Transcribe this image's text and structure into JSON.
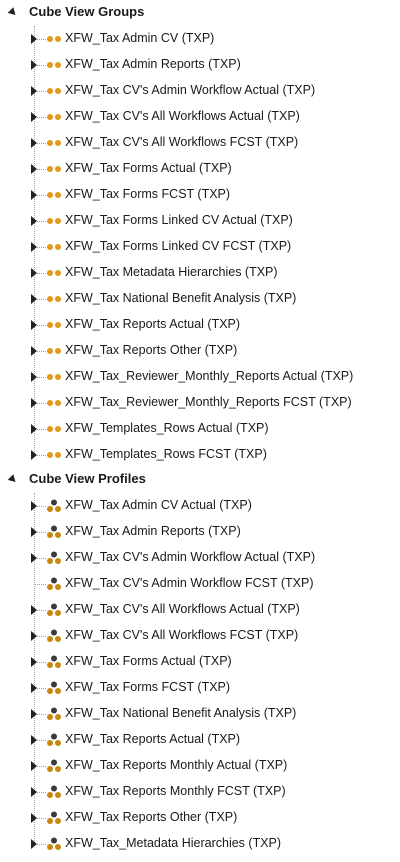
{
  "groups": [
    {
      "label": "Cube View Groups",
      "items": [
        {
          "label": "XFW_Tax Admin CV (TXP)",
          "expandable": true
        },
        {
          "label": "XFW_Tax Admin Reports (TXP)",
          "expandable": true
        },
        {
          "label": "XFW_Tax CV's Admin Workflow Actual (TXP)",
          "expandable": true
        },
        {
          "label": "XFW_Tax CV's All Workflows Actual (TXP)",
          "expandable": true
        },
        {
          "label": "XFW_Tax CV's All Workflows FCST (TXP)",
          "expandable": true
        },
        {
          "label": "XFW_Tax Forms Actual (TXP)",
          "expandable": true
        },
        {
          "label": "XFW_Tax Forms FCST (TXP)",
          "expandable": true
        },
        {
          "label": "XFW_Tax Forms Linked CV Actual (TXP)",
          "expandable": true
        },
        {
          "label": "XFW_Tax Forms Linked CV FCST (TXP)",
          "expandable": true
        },
        {
          "label": "XFW_Tax Metadata Hierarchies (TXP)",
          "expandable": true
        },
        {
          "label": "XFW_Tax National Benefit Analysis (TXP)",
          "expandable": true
        },
        {
          "label": "XFW_Tax Reports Actual (TXP)",
          "expandable": true
        },
        {
          "label": "XFW_Tax Reports Other (TXP)",
          "expandable": true
        },
        {
          "label": "XFW_Tax_Reviewer_Monthly_Reports Actual (TXP)",
          "expandable": true
        },
        {
          "label": "XFW_Tax_Reviewer_Monthly_Reports FCST (TXP)",
          "expandable": true
        },
        {
          "label": "XFW_Templates_Rows Actual (TXP)",
          "expandable": true
        },
        {
          "label": "XFW_Templates_Rows FCST (TXP)",
          "expandable": true
        }
      ]
    },
    {
      "label": "Cube View Profiles",
      "items": [
        {
          "label": "XFW_Tax Admin CV Actual (TXP)",
          "expandable": true
        },
        {
          "label": "XFW_Tax Admin Reports (TXP)",
          "expandable": true
        },
        {
          "label": "XFW_Tax CV's Admin Workflow Actual (TXP)",
          "expandable": true
        },
        {
          "label": "XFW_Tax CV's Admin Workflow FCST (TXP)",
          "expandable": false
        },
        {
          "label": "XFW_Tax CV's All Workflows Actual (TXP)",
          "expandable": true
        },
        {
          "label": "XFW_Tax CV's All Workflows FCST (TXP)",
          "expandable": true
        },
        {
          "label": "XFW_Tax Forms Actual (TXP)",
          "expandable": true
        },
        {
          "label": "XFW_Tax Forms FCST (TXP)",
          "expandable": true
        },
        {
          "label": "XFW_Tax National Benefit Analysis (TXP)",
          "expandable": true
        },
        {
          "label": "XFW_Tax Reports Actual (TXP)",
          "expandable": true
        },
        {
          "label": "XFW_Tax Reports Monthly Actual (TXP)",
          "expandable": true
        },
        {
          "label": "XFW_Tax Reports Monthly FCST (TXP)",
          "expandable": true
        },
        {
          "label": "XFW_Tax Reports Other (TXP)",
          "expandable": true
        },
        {
          "label": "XFW_Tax_Metadata Hierarchies (TXP)",
          "expandable": true
        }
      ]
    }
  ],
  "icons": {
    "group_icon": "cube-view-group-icon",
    "profile_icon": "cube-view-profile-icon",
    "accent_color": "#E39A1B",
    "profile_color": "#C7870F",
    "profile_dark": "#3a3a3a"
  }
}
